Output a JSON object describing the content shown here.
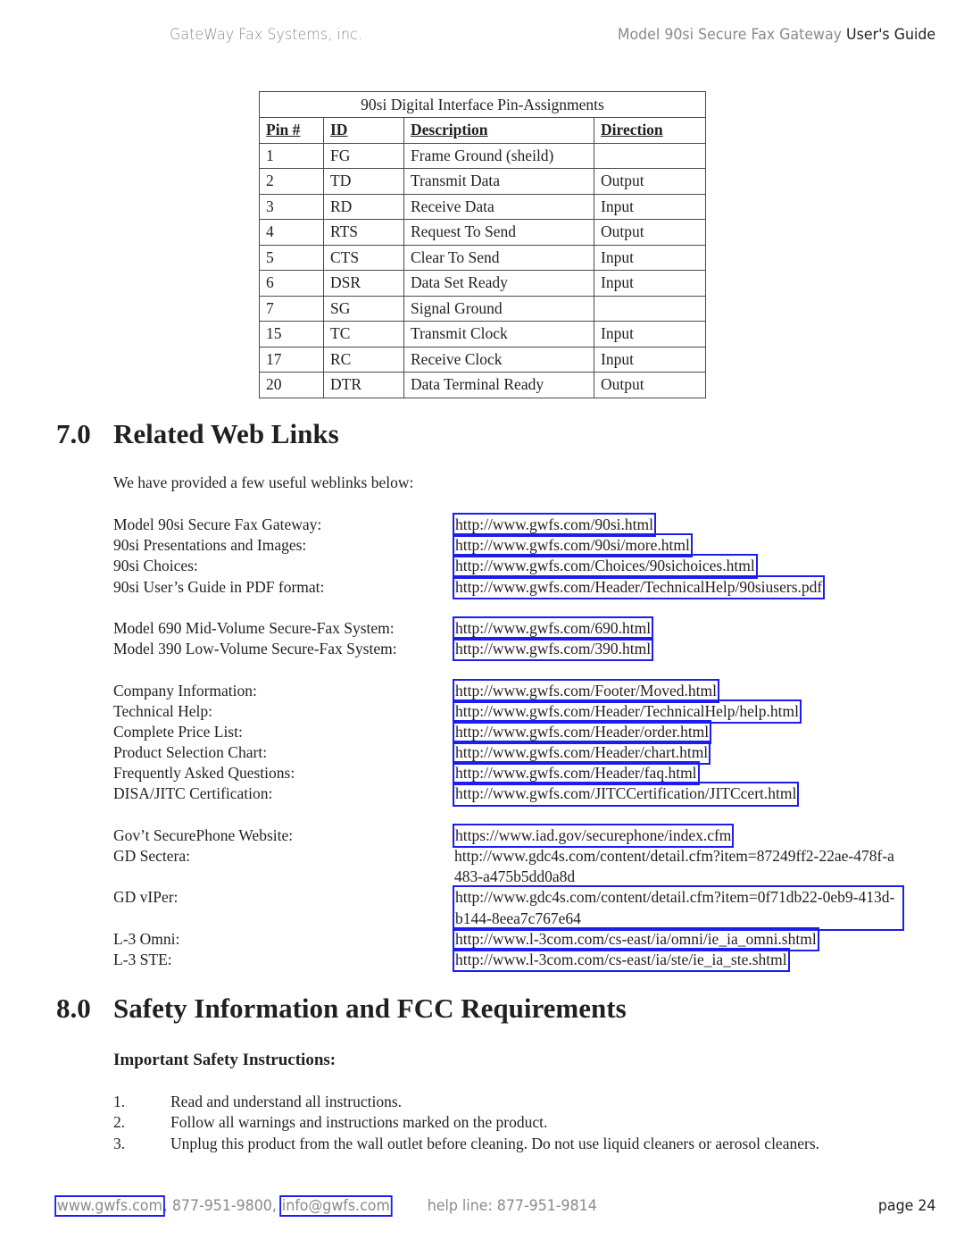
{
  "header": {
    "company": "GateWay Fax Systems, inc.",
    "product": "Model 90si Secure Fax Gateway",
    "doc": "User's Guide"
  },
  "pin_table": {
    "title": "90si Digital Interface Pin-Assignments",
    "columns": [
      "Pin #",
      "ID",
      "Description",
      "Direction"
    ],
    "rows": [
      [
        "1",
        "FG",
        "Frame Ground (sheild)",
        ""
      ],
      [
        "2",
        "TD",
        "Transmit Data",
        "Output"
      ],
      [
        "3",
        "RD",
        "Receive Data",
        "Input"
      ],
      [
        "4",
        "RTS",
        "Request To Send",
        "Output"
      ],
      [
        "5",
        "CTS",
        "Clear To Send",
        "Input"
      ],
      [
        "6",
        "DSR",
        "Data Set Ready",
        "Input"
      ],
      [
        "7",
        "SG",
        "Signal Ground",
        ""
      ],
      [
        "15",
        "TC",
        "Transmit Clock",
        "Input"
      ],
      [
        "17",
        "RC",
        "Receive Clock",
        "Input"
      ],
      [
        "20",
        "DTR",
        "Data Terminal Ready",
        "Output"
      ]
    ]
  },
  "section7": {
    "number": "7.0",
    "title": "Related Web Links",
    "intro": "We have provided a few useful weblinks below:",
    "links": [
      {
        "label": "Model 90si Secure Fax Gateway:",
        "url": "http://www.gwfs.com/90si.html",
        "boxed": true
      },
      {
        "label": "90si Presentations and Images:",
        "url": "http://www.gwfs.com/90si/more.html",
        "boxed": true
      },
      {
        "label": "90si Choices:",
        "url": "http://www.gwfs.com/Choices/90sichoices.html",
        "boxed": true
      },
      {
        "label": "90si User’s Guide in PDF format:",
        "url": "http://www.gwfs.com/Header/TechnicalHelp/90siusers.pdf",
        "boxed": true
      },
      {
        "label": "Model 690 Mid-Volume Secure-Fax System:",
        "url": "http://www.gwfs.com/690.html",
        "boxed": true
      },
      {
        "label": "Model 390 Low-Volume Secure-Fax System:",
        "url": "http://www.gwfs.com/390.html",
        "boxed": true
      },
      {
        "label": "Company Information:",
        "url": "http://www.gwfs.com/Footer/Moved.html",
        "boxed": true
      },
      {
        "label": "Technical Help:",
        "url": "http://www.gwfs.com/Header/TechnicalHelp/help.html",
        "boxed": true
      },
      {
        "label": "Complete Price List:",
        "url": "http://www.gwfs.com/Header/order.html",
        "boxed": true
      },
      {
        "label": "Product Selection Chart:",
        "url": "http://www.gwfs.com/Header/chart.html",
        "boxed": true
      },
      {
        "label": "Frequently Asked Questions:",
        "url": "http://www.gwfs.com/Header/faq.html",
        "boxed": true
      },
      {
        "label": "DISA/JITC Certification:",
        "url": "http://www.gwfs.com/JITCCertification/JITCcert.html",
        "boxed": true
      },
      {
        "label": "Gov’t SecurePhone Website:",
        "url": "https://www.iad.gov/securephone/index.cfm",
        "boxed": true
      },
      {
        "label": "GD Sectera:",
        "url": "http://www.gdc4s.com/content/detail.cfm?item=87249ff2-22ae-478f-a483-a475b5dd0a8d",
        "boxed": false
      },
      {
        "label": "GD vIPer:",
        "url": "http://www.gdc4s.com/content/detail.cfm?item=0f71db22-0eb9-413d-b144-8eea7c767e64",
        "boxed": true
      },
      {
        "label": "L-3 Omni:",
        "url": "http://www.l-3com.com/cs-east/ia/omni/ie_ia_omni.shtml",
        "boxed": true
      },
      {
        "label": "L-3 STE:",
        "url": "http://www.l-3com.com/cs-east/ia/ste/ie_ia_ste.shtml",
        "boxed": true
      }
    ]
  },
  "section8": {
    "number": "8.0",
    "title": "Safety Information and FCC Requirements",
    "subheading": "Important Safety Instructions:",
    "steps": [
      {
        "n": "1.",
        "text": "Read and understand all instructions."
      },
      {
        "n": "2.",
        "text": "Follow all warnings and instructions marked on the product."
      },
      {
        "n": "3.",
        "text": "Unplug this product from the wall outlet before cleaning. Do not use liquid cleaners or aerosol cleaners."
      }
    ]
  },
  "footer": {
    "website": "www.gwfs.com",
    "phone": ", 877-951-9800, ",
    "email": "info@gwfs.com",
    "helpline": "help line: 877-951-9814",
    "page": "page 24"
  },
  "colors": {
    "link_box": "#1d1df0",
    "header_gray": "#8a8a8a",
    "text": "#231f20"
  }
}
